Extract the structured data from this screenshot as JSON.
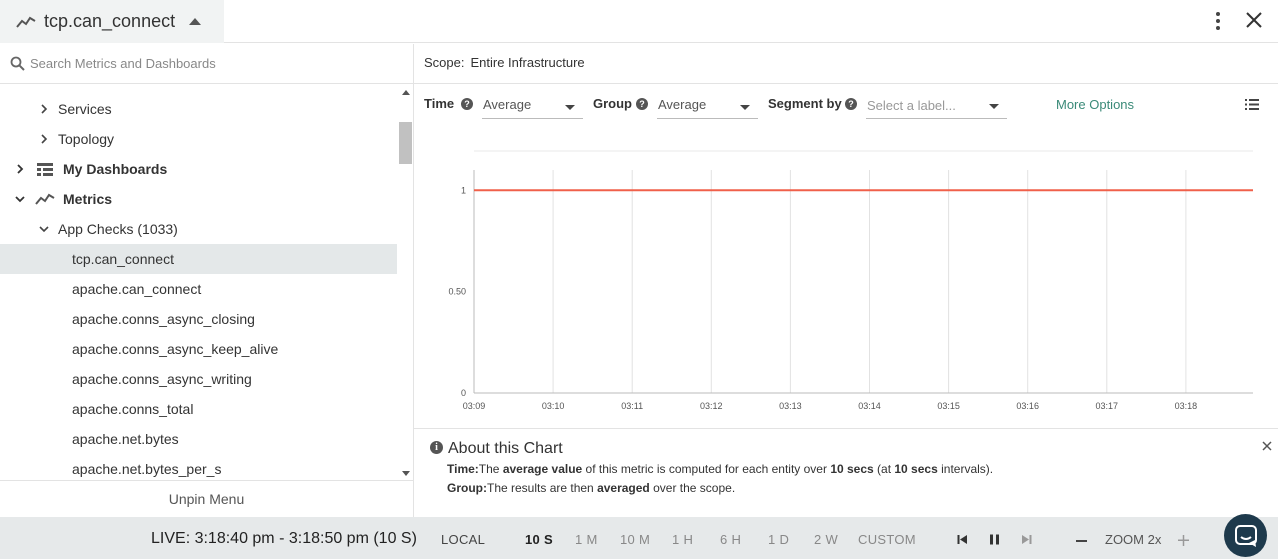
{
  "header": {
    "title": "tcp.can_connect"
  },
  "sidebar": {
    "search_placeholder": "Search Metrics and Dashboards",
    "items": [
      {
        "label": "Services",
        "chevron": "right"
      },
      {
        "label": "Topology",
        "chevron": "right"
      },
      {
        "label": "My Dashboards",
        "chevron": "right",
        "icon": "dashboard-icon"
      },
      {
        "label": "Metrics",
        "chevron": "down",
        "icon": "metrics-icon"
      },
      {
        "label": "App Checks (1033)",
        "chevron": "down"
      },
      {
        "label": "tcp.can_connect",
        "selected": true
      },
      {
        "label": "apache.can_connect"
      },
      {
        "label": "apache.conns_async_closing"
      },
      {
        "label": "apache.conns_async_keep_alive"
      },
      {
        "label": "apache.conns_async_writing"
      },
      {
        "label": "apache.conns_total"
      },
      {
        "label": "apache.net.bytes"
      },
      {
        "label": "apache.net.bytes_per_s"
      }
    ],
    "unpin_label": "Unpin Menu"
  },
  "scope": {
    "label": "Scope:",
    "value": "Entire Infrastructure"
  },
  "controls": {
    "time_label": "Time",
    "time_value": "Average",
    "group_label": "Group",
    "group_value": "Average",
    "segment_label": "Segment by",
    "segment_placeholder": "Select a label...",
    "more_options": "More Options"
  },
  "chart_data": {
    "type": "line",
    "x": [
      "03:09",
      "03:10",
      "03:11",
      "03:12",
      "03:13",
      "03:14",
      "03:15",
      "03:16",
      "03:17",
      "03:18"
    ],
    "series": [
      {
        "values": [
          1,
          1,
          1,
          1,
          1,
          1,
          1,
          1,
          1,
          1
        ],
        "color": "#f0604a"
      }
    ],
    "y_ticks": [
      "0",
      "0.50",
      "1"
    ],
    "ylim": [
      0,
      1.1
    ],
    "grid": "vertical",
    "title": "",
    "xlabel": "",
    "ylabel": ""
  },
  "about": {
    "heading": "About this Chart",
    "time_key": "Time:",
    "time_t1": "The ",
    "time_b1": "average value",
    "time_t2": " of this metric is computed for each entity over ",
    "time_b2": "10 secs",
    "time_t3": " (at ",
    "time_b3": "10 secs",
    "time_t4": " intervals).",
    "group_key": "Group:",
    "group_t1": "The results are then ",
    "group_b1": "averaged",
    "group_t2": " over the scope."
  },
  "bottom": {
    "live": "LIVE: 3:18:40 pm - 3:18:50 pm (10 S)",
    "local": "LOCAL",
    "ranges": [
      "10 S",
      "1 M",
      "10 M",
      "1 H",
      "6 H",
      "1 D",
      "2 W"
    ],
    "active_range": "10 S",
    "custom": "CUSTOM",
    "zoom": "ZOOM 2x"
  }
}
